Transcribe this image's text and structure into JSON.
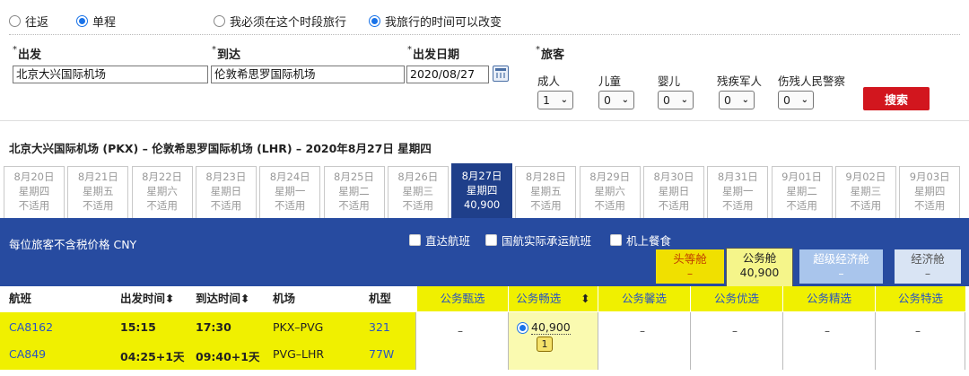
{
  "trip_type": {
    "round": "往返",
    "oneway": "单程"
  },
  "time_mode": {
    "fixed": "我必须在这个时段旅行",
    "flexible": "我旅行的时间可以改变"
  },
  "form": {
    "required_mark": "*",
    "origin_label": "出发",
    "origin_value": "北京大兴国际机场",
    "dest_label": "到达",
    "dest_value": "伦敦希思罗国际机场",
    "date_label": "出发日期",
    "date_value": "2020/08/27",
    "pax_label": "旅客",
    "pax": [
      {
        "label": "成人",
        "value": "1"
      },
      {
        "label": "儿童",
        "value": "0"
      },
      {
        "label": "婴儿",
        "value": "0"
      },
      {
        "label": "残疾军人",
        "value": "0"
      },
      {
        "label": "伤残人民警察",
        "value": "0"
      }
    ],
    "search_label": "搜索"
  },
  "route_title": "北京大兴国际机场 (PKX) – 伦敦希思罗国际机场 (LHR) – 2020年8月27日 星期四",
  "dates": [
    {
      "date": "8月20日",
      "dow": "星期四",
      "price": "不适用"
    },
    {
      "date": "8月21日",
      "dow": "星期五",
      "price": "不适用"
    },
    {
      "date": "8月22日",
      "dow": "星期六",
      "price": "不适用"
    },
    {
      "date": "8月23日",
      "dow": "星期日",
      "price": "不适用"
    },
    {
      "date": "8月24日",
      "dow": "星期一",
      "price": "不适用"
    },
    {
      "date": "8月25日",
      "dow": "星期二",
      "price": "不适用"
    },
    {
      "date": "8月26日",
      "dow": "星期三",
      "price": "不适用"
    },
    {
      "date": "8月27日",
      "dow": "星期四",
      "price": "40,900"
    },
    {
      "date": "8月28日",
      "dow": "星期五",
      "price": "不适用"
    },
    {
      "date": "8月29日",
      "dow": "星期六",
      "price": "不适用"
    },
    {
      "date": "8月30日",
      "dow": "星期日",
      "price": "不适用"
    },
    {
      "date": "8月31日",
      "dow": "星期一",
      "price": "不适用"
    },
    {
      "date": "9月01日",
      "dow": "星期二",
      "price": "不适用"
    },
    {
      "date": "9月02日",
      "dow": "星期三",
      "price": "不适用"
    },
    {
      "date": "9月03日",
      "dow": "星期四",
      "price": "不适用"
    }
  ],
  "band": {
    "price_note": "每位旅客不含税价格 CNY",
    "filters": [
      "直达航班",
      "国航实际承运航班",
      "机上餐食"
    ]
  },
  "cabins": [
    {
      "name": "头等舱",
      "price": "–",
      "color": "#f0e000"
    },
    {
      "name": "公务舱",
      "price": "40,900",
      "color": "#f5f58a"
    },
    {
      "name": "超级经济舱",
      "price": "–",
      "color": "#a9c5ec"
    },
    {
      "name": "经济舱",
      "price": "–",
      "color": "#d9e4f4"
    }
  ],
  "table_head": {
    "flight": "航班",
    "dep": "出发时间",
    "arr": "到达时间",
    "airport": "机场",
    "type": "机型",
    "sort_icon": "⬍"
  },
  "fares": [
    "公务甄选",
    "公务畅选",
    "公务馨选",
    "公务优选",
    "公务精选",
    "公务特选"
  ],
  "flights": [
    {
      "no": "CA8162",
      "dep": "15:15",
      "arr": "17:30",
      "route": "PKX–PVG",
      "type": "321"
    },
    {
      "no": "CA849",
      "dep": "04:25+1天",
      "arr": "09:40+1天",
      "route": "PVG–LHR",
      "type": "77W"
    }
  ],
  "fare_cells": {
    "dash": "–",
    "price": "40,900",
    "seats": "1"
  },
  "colors": {
    "brand_blue": "#274ba0",
    "highlight_yellow": "#f0f000",
    "search_red": "#d2161e"
  }
}
